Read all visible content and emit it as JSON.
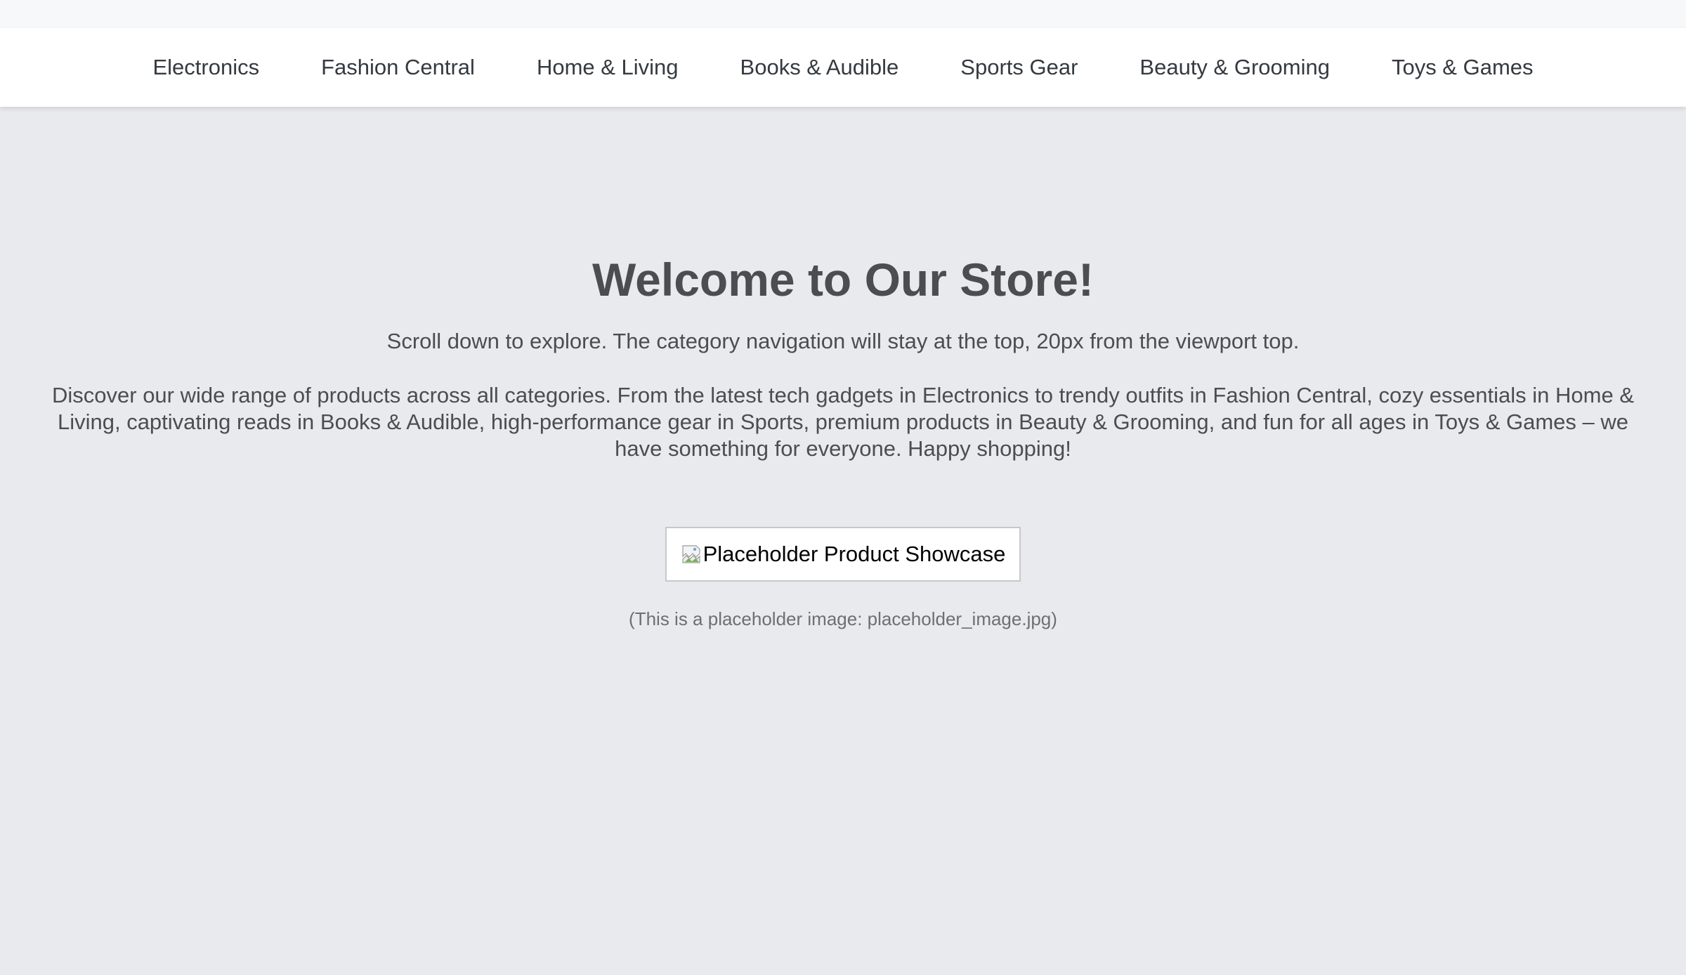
{
  "nav": {
    "items": [
      {
        "label": "Electronics"
      },
      {
        "label": "Fashion Central"
      },
      {
        "label": "Home & Living"
      },
      {
        "label": "Books & Audible"
      },
      {
        "label": "Sports Gear"
      },
      {
        "label": "Beauty & Grooming"
      },
      {
        "label": "Toys & Games"
      }
    ]
  },
  "hero": {
    "title": "Welcome to Our Store!",
    "subtitle": "Scroll down to explore. The category navigation will stay at the top, 20px from the viewport top.",
    "description": "Discover our wide range of products across all categories. From the latest tech gadgets in Electronics to trendy outfits in Fashion Central, cozy essentials in Home & Living, captivating reads in Books & Audible, high-performance gear in Sports, premium products in Beauty & Grooming, and fun for all ages in Toys & Games – we have something for everyone. Happy shopping!"
  },
  "showcase": {
    "alt_text": "Placeholder Product Showcase",
    "icon": "broken-image-icon",
    "caption": "(This is a placeholder image: placeholder_image.jpg)"
  },
  "colors": {
    "page_background": "#e9eaed",
    "nav_background": "#ffffff",
    "heading_text": "#4a4d52",
    "nav_text": "#343a40"
  }
}
